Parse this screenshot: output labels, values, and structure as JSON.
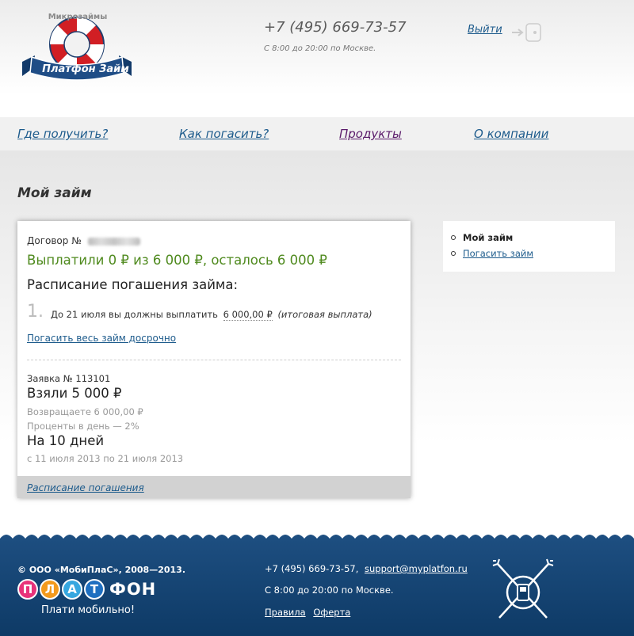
{
  "header": {
    "logo_top": "Микрозаймы",
    "logo_name": "Платфон Займ",
    "phone": "+7 (495) 669-73-57",
    "hours": "С 8:00 до 20:00 по Москве.",
    "logout": "Выйти"
  },
  "nav": {
    "items": [
      {
        "label": "Где получить?"
      },
      {
        "label": "Как погасить?"
      },
      {
        "label": "Продукты"
      },
      {
        "label": "О компании"
      }
    ]
  },
  "page_title": "Мой займ",
  "loan": {
    "contract_label": "Договор №",
    "paid_summary": "Выплатили 0 ₽ из 6 000 ₽, осталось 6 000 ₽",
    "schedule_title": "Расписание погашения займа:",
    "schedule": [
      {
        "num": "1.",
        "text_before": "До 21 июля вы должны выплатить",
        "amount": "6 000,00 ₽",
        "note": "(итоговая выплата)"
      }
    ],
    "early_repay_link": "Погасить весь займ досрочно",
    "application_label": "Заявка № 113101",
    "took": "Взяли 5 000 ₽",
    "returns": "Возвращаете 6 000,00 ₽",
    "interest": "Проценты в день — 2%",
    "term": "На 10 дней",
    "dates": "с 11 июля 2013 по 21 июля 2013",
    "footer_link": "Расписание погашения"
  },
  "sidebar": {
    "items": [
      {
        "label": "Мой займ",
        "current": true
      },
      {
        "label": "Погасить займ",
        "current": false
      }
    ]
  },
  "footer": {
    "copyright": "© ООО «МобиПлаС», 2008—2013.",
    "brand_letters": [
      "П",
      "Л",
      "А",
      "Т"
    ],
    "brand_rest": "ФОН",
    "slogan": "Плати мобильно!",
    "phone": "+7 (495) 669-73-57,",
    "email": "support@myplatfon.ru",
    "hours": "С 8:00 до 20:00 по Москве.",
    "links": [
      "Правила",
      "Оферта"
    ]
  },
  "colors": {
    "link": "#1d5b8c",
    "paid_green": "#4f8a1e",
    "footer_blue": "#1d4e80",
    "brand_letters": [
      "#e8337a",
      "#f39a1d",
      "#35a7e0",
      "#1e6fc0"
    ]
  }
}
